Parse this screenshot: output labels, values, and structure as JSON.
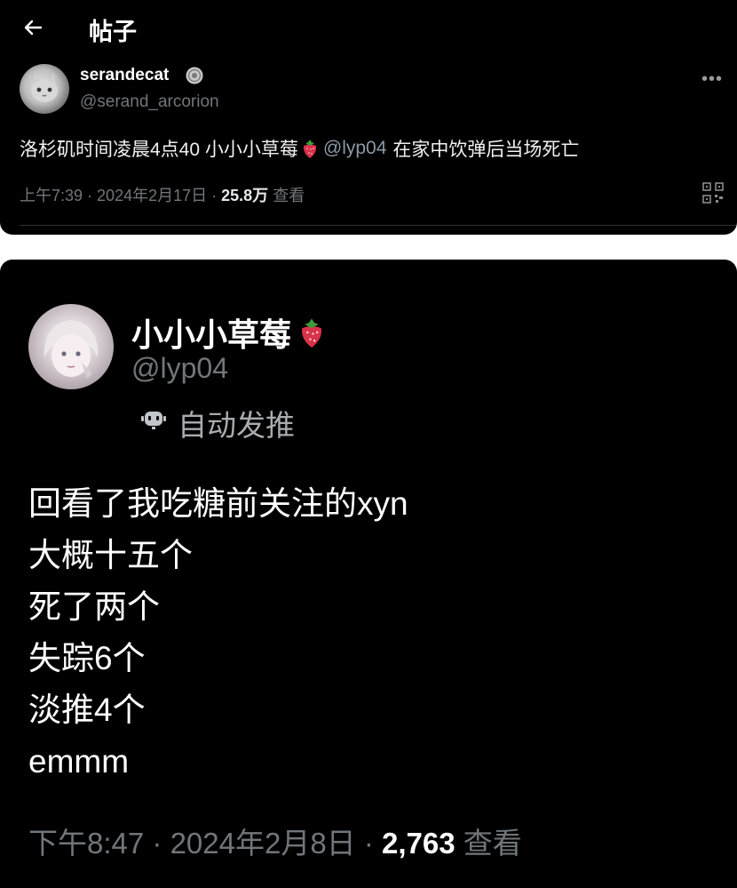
{
  "header": {
    "back_icon": "arrow-left-icon",
    "title": "帖子"
  },
  "post": {
    "author": {
      "name": "serandecat",
      "handle": "@serand_arcorion",
      "verified_icon": "verified-badge-icon"
    },
    "more_icon": "more-horizontal-icon",
    "text": {
      "before": "洛杉矶时间凌晨4点40 小小小草莓",
      "mention": "@lyp04",
      "after": "在家中饮弹后当场死亡"
    },
    "meta": {
      "time": "上午7:39",
      "sep1": " · ",
      "date": "2024年2月17日",
      "sep2": " · ",
      "views": "25.8万",
      "views_label": "查看"
    },
    "qr_icon": "qr-code-icon"
  },
  "quoted": {
    "author": {
      "name": "小小小草莓",
      "handle": "@lyp04",
      "emoji_icon": "strawberry-icon"
    },
    "bot_label": "自动发推",
    "bot_icon": "robot-icon",
    "lines": [
      "回看了我吃糖前关注的xyn",
      "大概十五个",
      "死了两个",
      "失踪6个",
      "淡推4个",
      "emmm"
    ],
    "meta": {
      "time": "下午8:47",
      "sep1": " · ",
      "date": "2024年2月8日",
      "sep2": " · ",
      "views": "2,763",
      "views_label": "查看"
    }
  },
  "colors": {
    "background": "#000000",
    "text": "#e7e9ea",
    "secondary": "#71767b",
    "mention": "#8b98a5",
    "strawberry": "#d9324a"
  }
}
